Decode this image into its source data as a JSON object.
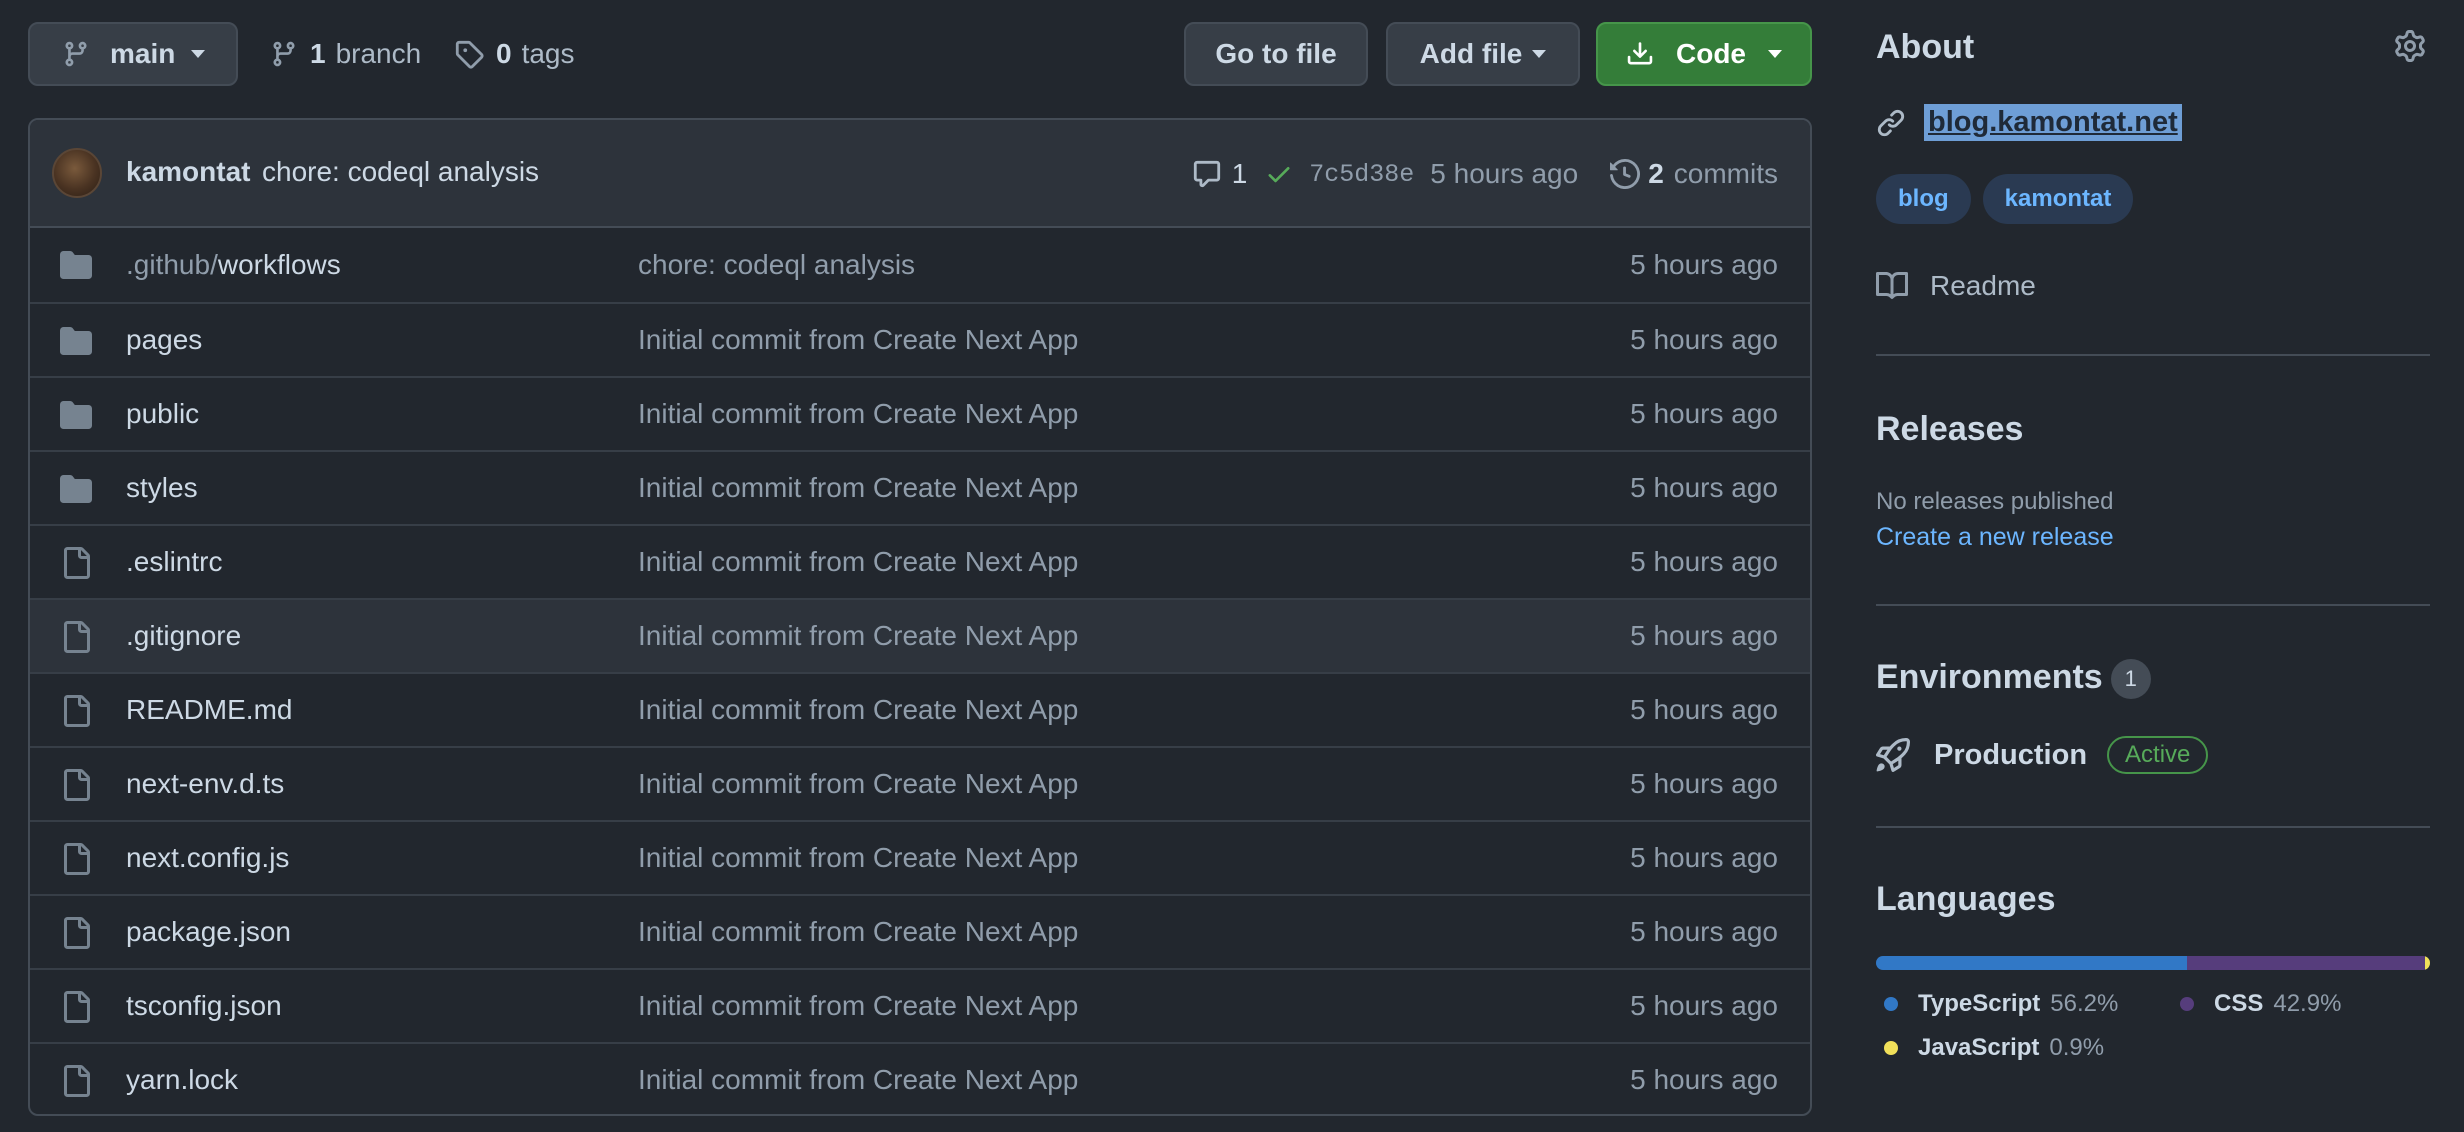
{
  "toolbar": {
    "branch": "main",
    "branch_count": "1",
    "branch_word": "branch",
    "tag_count": "0",
    "tag_word": "tags",
    "go_to_file": "Go to file",
    "add_file": "Add file",
    "code": "Code"
  },
  "commit": {
    "author": "kamontat",
    "message": "chore: codeql analysis",
    "comment_count": "1",
    "sha": "7c5d38e",
    "time": "5 hours ago",
    "commits_count": "2",
    "commits_word": "commits"
  },
  "files": [
    {
      "type": "folder",
      "prefix": ".github/",
      "name": "workflows",
      "message": "chore: codeql analysis",
      "time": "5 hours ago"
    },
    {
      "type": "folder",
      "prefix": "",
      "name": "pages",
      "message": "Initial commit from Create Next App",
      "time": "5 hours ago"
    },
    {
      "type": "folder",
      "prefix": "",
      "name": "public",
      "message": "Initial commit from Create Next App",
      "time": "5 hours ago"
    },
    {
      "type": "folder",
      "prefix": "",
      "name": "styles",
      "message": "Initial commit from Create Next App",
      "time": "5 hours ago"
    },
    {
      "type": "file",
      "prefix": "",
      "name": ".eslintrc",
      "message": "Initial commit from Create Next App",
      "time": "5 hours ago"
    },
    {
      "type": "file",
      "prefix": "",
      "name": ".gitignore",
      "message": "Initial commit from Create Next App",
      "time": "5 hours ago"
    },
    {
      "type": "file",
      "prefix": "",
      "name": "README.md",
      "message": "Initial commit from Create Next App",
      "time": "5 hours ago"
    },
    {
      "type": "file",
      "prefix": "",
      "name": "next-env.d.ts",
      "message": "Initial commit from Create Next App",
      "time": "5 hours ago"
    },
    {
      "type": "file",
      "prefix": "",
      "name": "next.config.js",
      "message": "Initial commit from Create Next App",
      "time": "5 hours ago"
    },
    {
      "type": "file",
      "prefix": "",
      "name": "package.json",
      "message": "Initial commit from Create Next App",
      "time": "5 hours ago"
    },
    {
      "type": "file",
      "prefix": "",
      "name": "tsconfig.json",
      "message": "Initial commit from Create Next App",
      "time": "5 hours ago"
    },
    {
      "type": "file",
      "prefix": "",
      "name": "yarn.lock",
      "message": "Initial commit from Create Next App",
      "time": "5 hours ago"
    }
  ],
  "about": {
    "title": "About",
    "website": "blog.kamontat.net",
    "topics": [
      "blog",
      "kamontat"
    ],
    "readme": "Readme"
  },
  "releases": {
    "title": "Releases",
    "none": "No releases published",
    "create": "Create a new release"
  },
  "environments": {
    "title": "Environments",
    "count": "1",
    "name": "Production",
    "status": "Active"
  },
  "languages": {
    "title": "Languages",
    "items": [
      {
        "name": "TypeScript",
        "percent": "56.2%",
        "value": 56.2,
        "color": "#3178c6"
      },
      {
        "name": "CSS",
        "percent": "42.9%",
        "value": 42.9,
        "color": "#563d7c"
      },
      {
        "name": "JavaScript",
        "percent": "0.9%",
        "value": 0.9,
        "color": "#f1e05a"
      }
    ]
  },
  "colors": {
    "accent": "#6cb6ff",
    "success": "#57ab5a",
    "code_button": "#347d39"
  }
}
